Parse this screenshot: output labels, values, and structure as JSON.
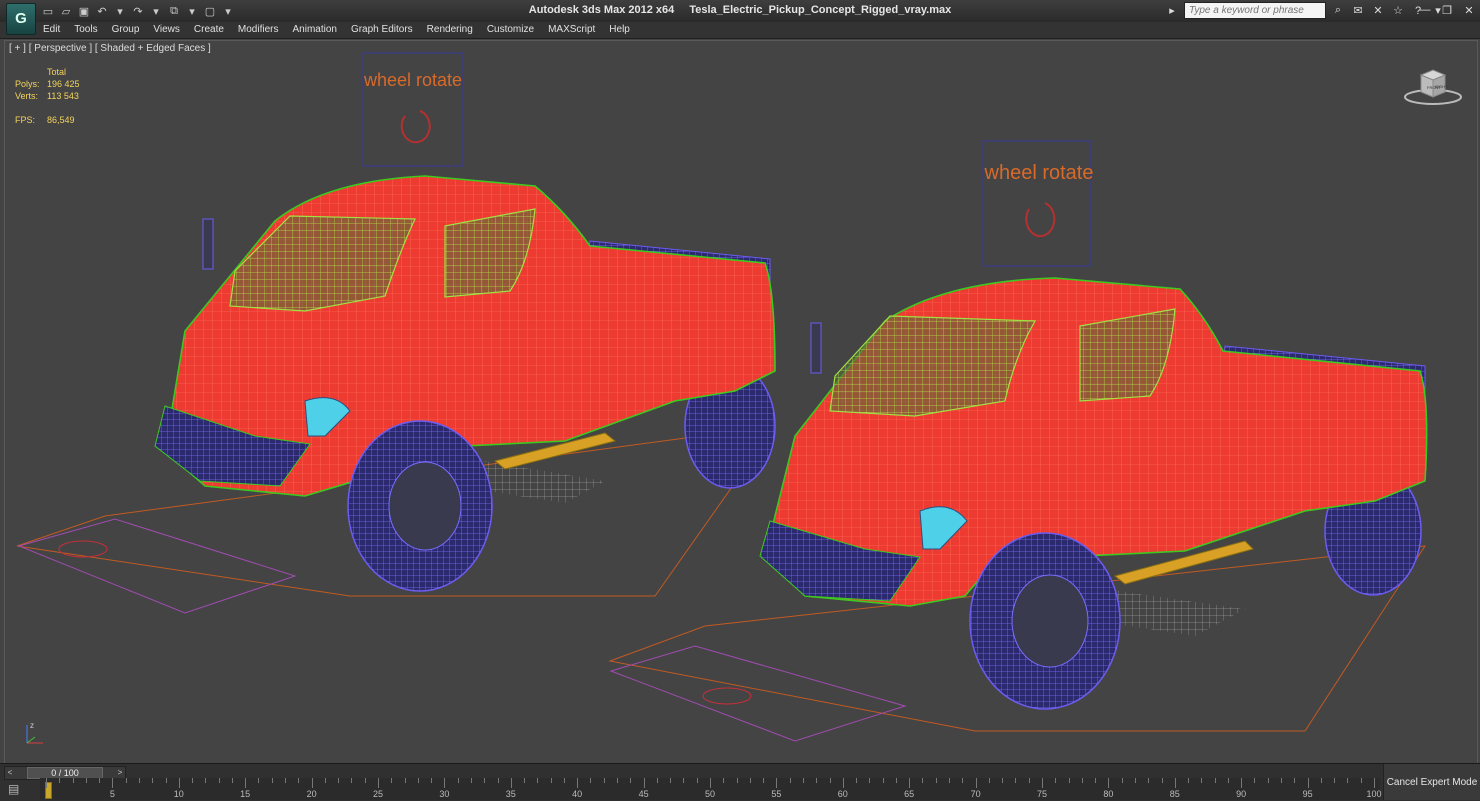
{
  "app": {
    "logo_letter": "G",
    "title": "Autodesk 3ds Max  2012 x64",
    "file": "Tesla_Electric_Pickup_Concept_Rigged_vray.max"
  },
  "quick_access": [
    {
      "name": "new-icon",
      "glyph": "▭"
    },
    {
      "name": "open-icon",
      "glyph": "▱"
    },
    {
      "name": "save-icon",
      "glyph": "▣"
    },
    {
      "name": "undo-icon",
      "glyph": "↶"
    },
    {
      "name": "undo-dropdown-icon",
      "glyph": "▾"
    },
    {
      "name": "redo-icon",
      "glyph": "↷"
    },
    {
      "name": "redo-dropdown-icon",
      "glyph": "▾"
    },
    {
      "name": "hold-icon",
      "glyph": "⧉"
    },
    {
      "name": "fetch-icon",
      "glyph": "▾"
    },
    {
      "name": "project-icon",
      "glyph": "▢"
    },
    {
      "name": "customize-dropdown-icon",
      "glyph": "▾"
    }
  ],
  "search": {
    "placeholder": "Type a keyword or phrase"
  },
  "info_icons": [
    {
      "name": "binoculars-icon",
      "glyph": "⌕"
    },
    {
      "name": "communication-center-icon",
      "glyph": "✉"
    },
    {
      "name": "tools-icon",
      "glyph": "✕"
    },
    {
      "name": "favorites-icon",
      "glyph": "☆"
    },
    {
      "name": "help-icon",
      "glyph": "?"
    },
    {
      "name": "help-dropdown-icon",
      "glyph": "▾"
    }
  ],
  "menu": [
    "Edit",
    "Tools",
    "Group",
    "Views",
    "Create",
    "Modifiers",
    "Animation",
    "Graph Editors",
    "Rendering",
    "Customize",
    "MAXScript",
    "Help"
  ],
  "viewport": {
    "label": "[ + ] [ Perspective ] [ Shaded + Edged Faces ]",
    "stats": {
      "header": "Total",
      "polys_label": "Polys:",
      "polys": "196 425",
      "verts_label": "Verts:",
      "verts": "113 543",
      "fps_label": "FPS:",
      "fps": "86,549"
    },
    "rig_label": "wheel rotate",
    "viewcube_front": "FRONT",
    "viewcube_right": "RIGHT",
    "axis_z": "z"
  },
  "colors": {
    "body": "#ee3b32",
    "body_edges": "#ff6a55",
    "trim_green": "#3ec91f",
    "glass_green": "#a3e044",
    "wheel_blue": "#6c5cf0",
    "rig_orange": "#d86a2a",
    "stats_yellow": "#f3d35c"
  },
  "timeline": {
    "slider": "0 / 100",
    "ticks": [
      5,
      10,
      15,
      20,
      25,
      30,
      35,
      40,
      45,
      50,
      55,
      60,
      65,
      70,
      75,
      80,
      85,
      90,
      95,
      100
    ],
    "cancel": "Cancel Expert Mode"
  }
}
